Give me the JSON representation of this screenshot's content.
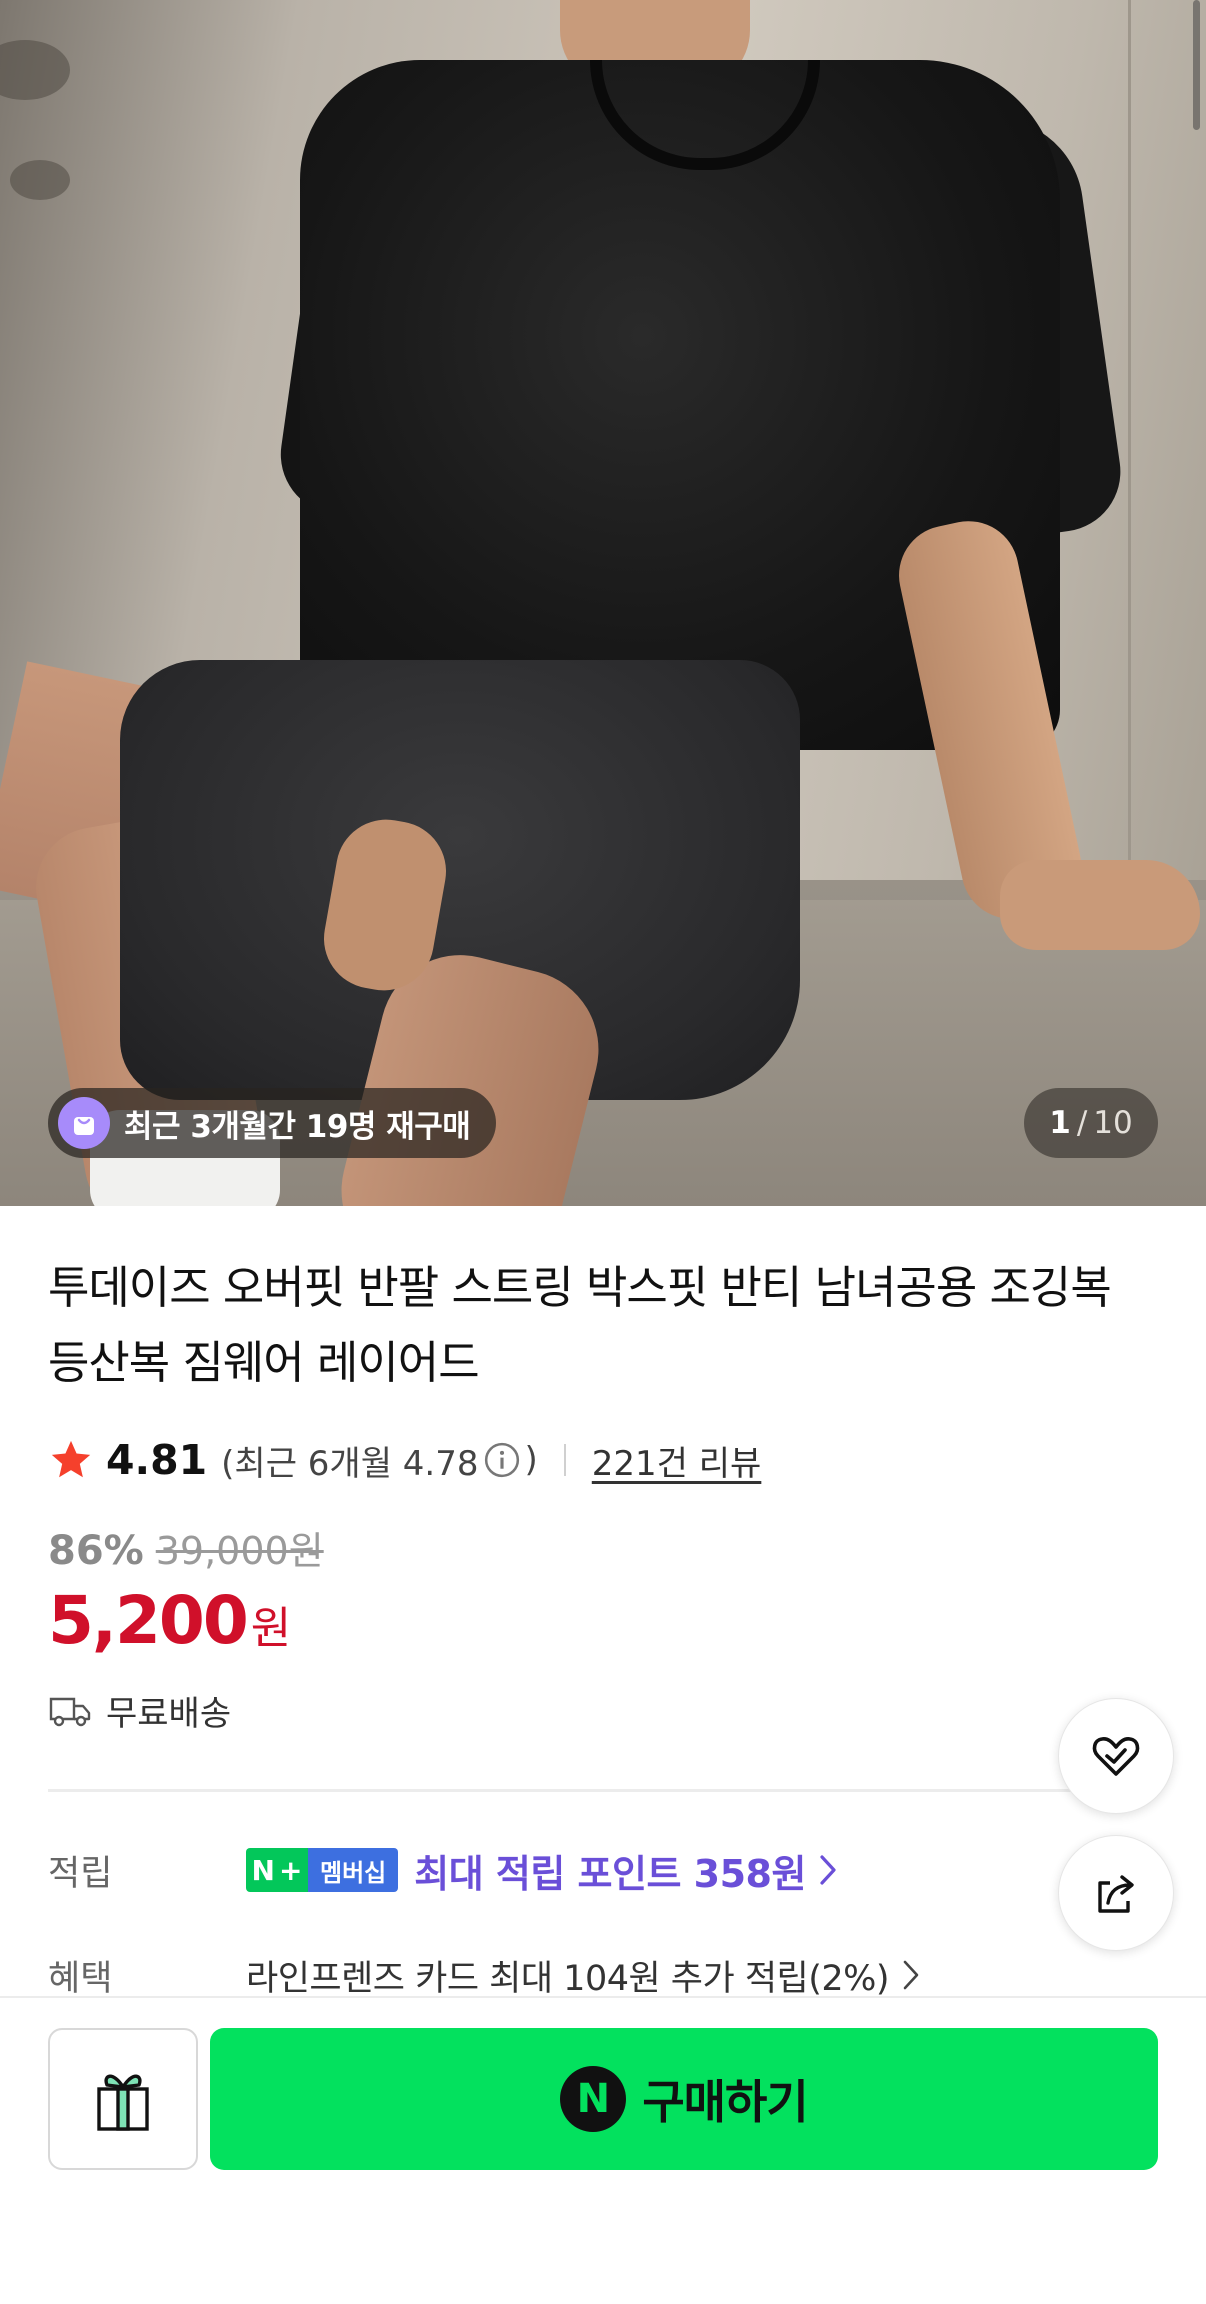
{
  "gallery": {
    "repurchase_badge": "최근 3개월간 19명 재구매",
    "current_index": "1",
    "separator": "/",
    "total": "10"
  },
  "product": {
    "title": "투데이즈 오버핏 반팔 스트링 박스핏 반티 남녀공용 조깅복 등산복 짐웨어 레이어드",
    "rating": "4.81",
    "recent_rating_open": "(최근 6개월 4.78",
    "recent_rating_close": ")",
    "reviews": "221건 리뷰",
    "discount_rate": "86%",
    "original_price": "39,000원",
    "price": "5,200",
    "price_unit": "원",
    "shipping": "무료배송"
  },
  "points": {
    "label": "적립",
    "badge_n": "N",
    "badge_plus": "+",
    "badge_membership": "멤버십",
    "text": "최대 적립 포인트 358원"
  },
  "benefit": {
    "label": "혜택",
    "text": "라인프렌즈 카드 최대 104원 추가 적립(2%)"
  },
  "actions": {
    "buy_icon": "N",
    "buy_label": "구매하기"
  },
  "icons": {
    "star": "star-icon",
    "info": "info-icon",
    "truck": "truck-icon",
    "zzim": "heart-check-icon",
    "share": "share-icon",
    "gift": "gift-icon",
    "bag": "shopping-bag-icon"
  },
  "colors": {
    "price": "#d0102a",
    "points": "#6a4fd8",
    "buy_button": "#03e15e",
    "naver_green": "#03c75a",
    "star": "#f5402c"
  }
}
